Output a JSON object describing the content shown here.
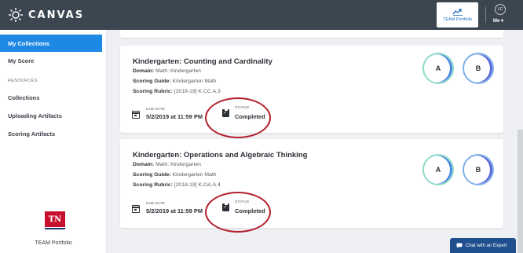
{
  "header": {
    "app_name": "CANVAS",
    "team_portfolio_label": "TEAM Portfolio",
    "avatar_initials": "LC",
    "user_menu_label": "Me"
  },
  "sidebar": {
    "items": [
      {
        "label": "My Collections",
        "active": true
      },
      {
        "label": "My Score",
        "active": false
      }
    ],
    "resources_heading": "RESOURCES",
    "resource_items": [
      {
        "label": "Collections"
      },
      {
        "label": "Uploading Artifacts"
      },
      {
        "label": "Scoring Artifacts"
      }
    ],
    "footer_logo_text": "TN",
    "footer_caption": "TEAM Portfolio"
  },
  "collections": [
    {
      "title": "Kindergarten: Counting and Cardinality",
      "domain_label": "Domain:",
      "domain": "Math: Kindergarten",
      "guide_label": "Scoring Guide:",
      "guide": "Kindergarten Math",
      "rubric_label": "Scoring Rubric:",
      "rubric": "[2018-19] K.CC.A.3",
      "due_label": "DUE DATE",
      "due_value": "5/2/2019 at 11:59 PM",
      "status_label": "STATUS",
      "status_value": "Completed",
      "score_a": "A",
      "score_b": "B"
    },
    {
      "title": "Kindergarten: Operations and Algebraic Thinking",
      "domain_label": "Domain:",
      "domain": "Math: Kindergarten",
      "guide_label": "Scoring Guide:",
      "guide": "Kindergarten Math",
      "rubric_label": "Scoring Rubric:",
      "rubric": "[2018-19] K.OA.A.4",
      "due_label": "DUE DATE",
      "due_value": "5/2/2019 at 11:59 PM",
      "status_label": "STATUS",
      "status_value": "Completed",
      "score_a": "A",
      "score_b": "B"
    }
  ],
  "chat": {
    "label": "Chat with an Expert"
  },
  "colors": {
    "topbar": "#3c4650",
    "active_nav": "#1e88e5",
    "highlight_ring": "#b3202d",
    "chat_button": "#1f4f8f"
  },
  "icons": {
    "logo": "canvas-logo-icon",
    "portfolio": "team-portfolio-icon",
    "due_date": "calendar-icon",
    "status": "clipboard-check-icon",
    "chat": "chat-bubble-icon"
  }
}
